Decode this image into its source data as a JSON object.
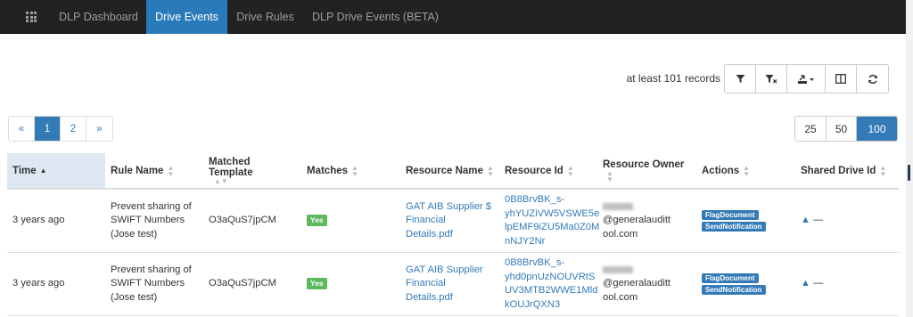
{
  "nav": {
    "apps_icon": "apps-grid-icon",
    "items": [
      {
        "label": "DLP Dashboard",
        "active": false
      },
      {
        "label": "Drive Events",
        "active": true
      },
      {
        "label": "Drive Rules",
        "active": false
      },
      {
        "label": "DLP Drive Events (BETA)",
        "active": false
      }
    ]
  },
  "records_text": "at least 101 records",
  "toolbar": {
    "icons": [
      "filter-icon",
      "clear-filter-icon",
      "export-icon",
      "columns-icon",
      "refresh-icon"
    ]
  },
  "pagination": {
    "prev": "«",
    "pages": [
      "1",
      "2"
    ],
    "next": "»",
    "current": "1"
  },
  "page_sizes": {
    "options": [
      "25",
      "50",
      "100"
    ],
    "selected": "100"
  },
  "table": {
    "columns": [
      "Time",
      "Rule Name",
      "Matched Template",
      "Matches",
      "Resource Name",
      "Resource Id",
      "Resource Owner",
      "Actions",
      "Shared Drive Id"
    ],
    "sorted_column": "Time",
    "rows": [
      {
        "time": "3 years ago",
        "rule_name": "Prevent sharing of SWIFT Numbers (Jose test)",
        "matched_template": "O3aQuS7jpCM",
        "matches": "Yes",
        "resource_name": "GAT AIB Supplier $ Financial Details.pdf",
        "resource_id_lines": [
          "0B8BrvBK_s-",
          "yhYUZiVW5VSWE5e",
          "lpEMF9iZU5Ma0Z0M",
          "nNJY2Nr"
        ],
        "owner_line1": "@generalauditt",
        "owner_line2": "ool.com",
        "actions": [
          "FlagDocument",
          "SendNotification"
        ],
        "shared_drive_id": "—"
      },
      {
        "time": "3 years ago",
        "rule_name": "Prevent sharing of SWIFT Numbers (Jose test)",
        "matched_template": "O3aQuS7jpCM",
        "matches": "Yes",
        "resource_name": "GAT AIB Supplier Financial Details.pdf",
        "resource_id_lines": [
          "0B8BrvBK_s-",
          "yhd0pnUzNOUVRtS",
          "UV3MTB2WWE1Mld",
          "kOUJrQXN3"
        ],
        "owner_line1": "@generalauditt",
        "owner_line2": "ool.com",
        "actions": [
          "FlagDocument",
          "SendNotification"
        ],
        "shared_drive_id": "—"
      }
    ]
  }
}
